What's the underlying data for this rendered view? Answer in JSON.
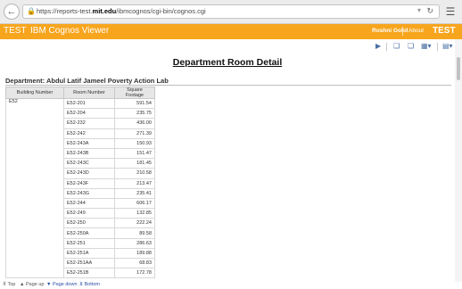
{
  "browser": {
    "url_prefix": "https://reports-test.",
    "url_host": "mit.edu",
    "url_path": "/ibmcognos/cgi-bin/cognos.cgi"
  },
  "header": {
    "env": "TEST",
    "title": "IBM Cognos Viewer",
    "user": "Roshni Gohil",
    "about": "About",
    "env_right": "TEST",
    "color": "#f7a51d"
  },
  "report": {
    "title": "Department Room Detail",
    "department": "Department: Abdul Latif Jameel Poverty Action Lab",
    "columns": [
      "Building Number",
      "Room Number",
      "Square Footage"
    ],
    "building": "E52",
    "rows": [
      [
        "E52-201",
        "591.54"
      ],
      [
        "E52-204",
        "235.75"
      ],
      [
        "E52-232",
        "436.00"
      ],
      [
        "E52-242",
        "271.39"
      ],
      [
        "E52-243A",
        "150.93"
      ],
      [
        "E52-243B",
        "151.47"
      ],
      [
        "E52-243C",
        "181.45"
      ],
      [
        "E52-243D",
        "210.58"
      ],
      [
        "E52-243F",
        "213.47"
      ],
      [
        "E52-243G",
        "235.41"
      ],
      [
        "E52-244",
        "606.17"
      ],
      [
        "E52-249",
        "132.85"
      ],
      [
        "E52-250",
        "222.24"
      ],
      [
        "E52-250A",
        "89.58"
      ],
      [
        "E52-251",
        "286.63"
      ],
      [
        "E52-251A",
        "189.88"
      ],
      [
        "E52-251AA",
        "68.83"
      ],
      [
        "E52-251B",
        "172.78"
      ]
    ]
  },
  "footer": {
    "top": "Top",
    "page_up": "Page up",
    "page_down": "Page down",
    "bottom": "Bottom"
  }
}
